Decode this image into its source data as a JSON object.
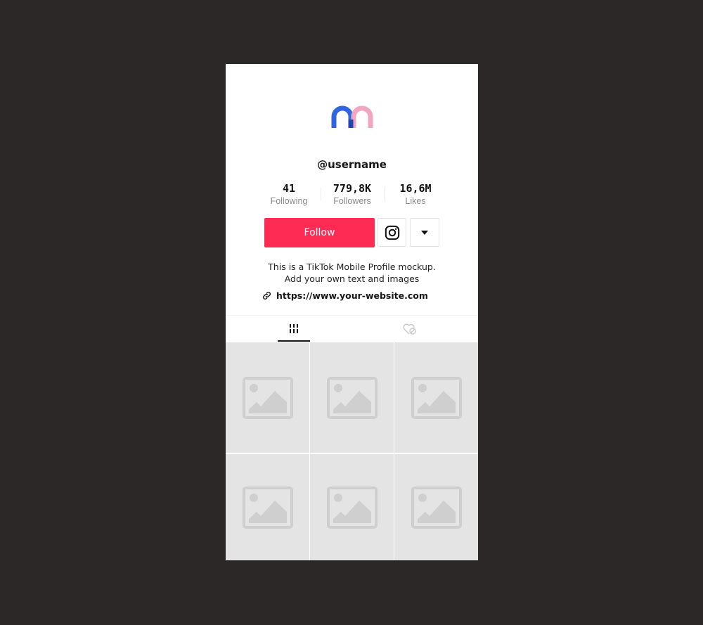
{
  "profile": {
    "username": "@username",
    "logo_colors": {
      "left": "#2f66e0",
      "right": "#f3a6c2"
    },
    "stats": [
      {
        "value": "41",
        "label": "Following"
      },
      {
        "value": "779,8K",
        "label": "Followers"
      },
      {
        "value": "16,6M",
        "label": "Likes"
      }
    ],
    "follow_label": "Follow",
    "accent_color": "#fe2c55",
    "bio_lines": [
      "This is a TikTok Mobile Profile mockup.",
      "Add your own text and images"
    ],
    "website": "https://www.your-website.com"
  },
  "tabs": [
    {
      "name": "videos",
      "icon": "grid-bars-icon",
      "active": true
    },
    {
      "name": "liked",
      "icon": "heart-hidden-icon",
      "active": false
    }
  ],
  "grid": {
    "tiles": [
      {
        "icon": "image-placeholder-icon"
      },
      {
        "icon": "image-placeholder-icon"
      },
      {
        "icon": "image-placeholder-icon"
      },
      {
        "icon": "image-placeholder-icon"
      },
      {
        "icon": "image-placeholder-icon"
      },
      {
        "icon": "image-placeholder-icon"
      }
    ]
  }
}
